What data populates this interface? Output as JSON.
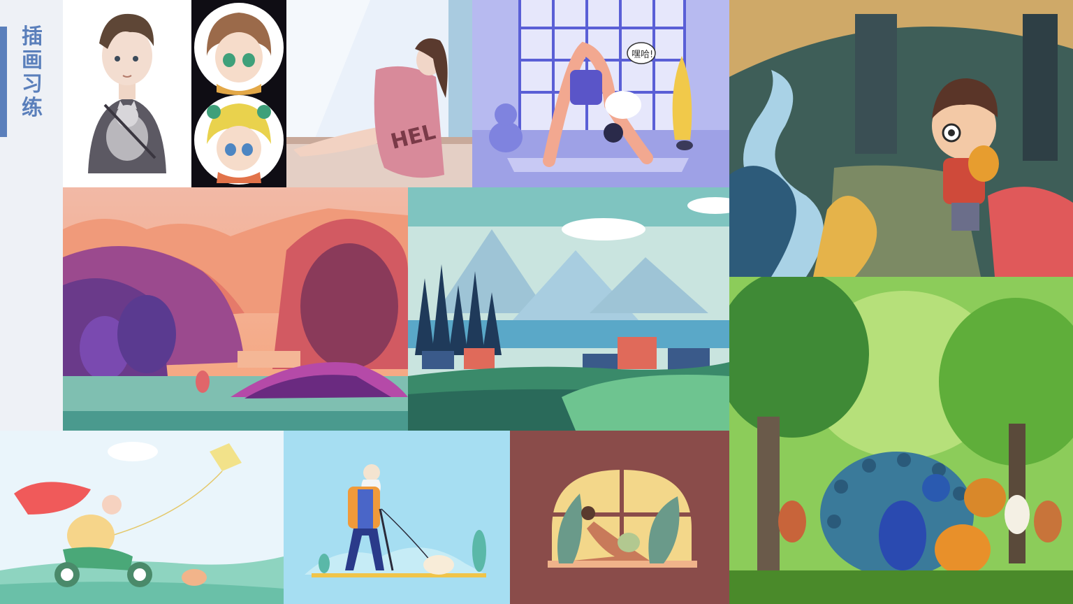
{
  "title_chars": [
    "插",
    "画",
    "习",
    "练"
  ],
  "tiles": {
    "t1": {
      "icon": "boy-with-cat-illustration"
    },
    "t2": {
      "icon": "chibi-girl-portraits-illustration"
    },
    "t3": {
      "icon": "woman-by-window-illustration",
      "jacket_text": "HEL"
    },
    "t4": {
      "icon": "yoga-girl-illustration",
      "speech_text": "嘿哈!"
    },
    "t5": {
      "icon": "boy-with-fish-forest-illustration"
    },
    "t6": {
      "icon": "sunset-lake-landscape-illustration"
    },
    "t7": {
      "icon": "mountain-village-landscape-illustration"
    },
    "t8": {
      "icon": "peacock-forest-animals-illustration"
    },
    "t9": {
      "icon": "girl-on-scooter-kite-illustration"
    },
    "t10": {
      "icon": "old-man-walking-dog-illustration"
    },
    "t11": {
      "icon": "woman-yoga-window-illustration"
    }
  },
  "colors": {
    "accent": "#5a7fbb",
    "side_panel": "#eef1f6"
  }
}
